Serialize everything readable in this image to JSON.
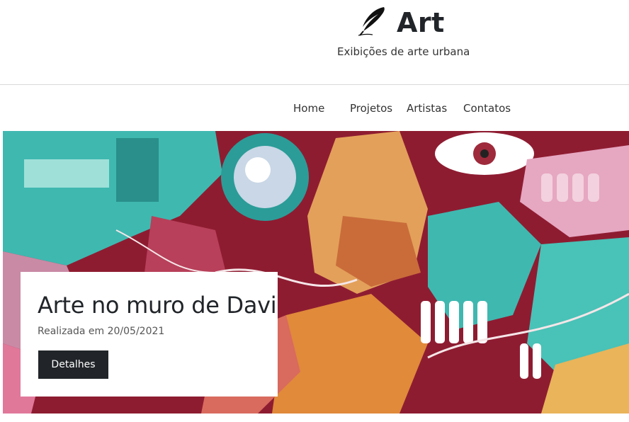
{
  "brand": {
    "icon": "feather-icon",
    "title": "Art",
    "tagline": "Exibições de arte urbana"
  },
  "nav": [
    {
      "label": "Home"
    },
    {
      "label": "Projetos"
    },
    {
      "label": "Artistas"
    },
    {
      "label": "Contatos"
    }
  ],
  "hero": {
    "image": "graffiti-mural",
    "card": {
      "title": "Arte no muro de Davi",
      "date": "Realizada em 20/05/2021",
      "button": "Detalhes"
    }
  },
  "colors": {
    "button_bg": "#212529",
    "mural_teal": "#3fb8b0",
    "mural_red": "#a5172d",
    "mural_orange": "#e08a3a"
  }
}
